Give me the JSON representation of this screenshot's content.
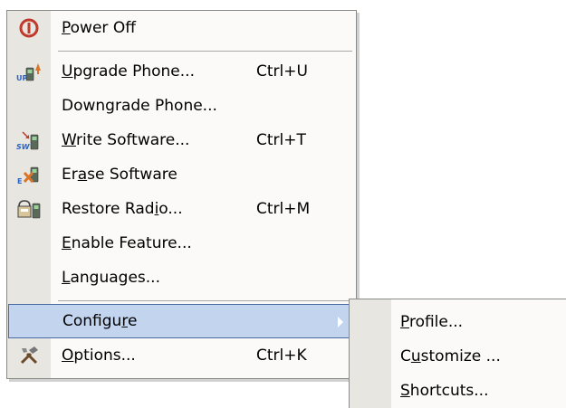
{
  "menu": {
    "items": [
      {
        "id": "power-off",
        "label": "Power Off",
        "mnemonic_index": 0,
        "shortcut": "",
        "icon": "power-icon"
      },
      {
        "id": "upgrade-phone",
        "label": "Upgrade Phone...",
        "mnemonic_index": 0,
        "shortcut": "Ctrl+U",
        "icon": "upgrade-phone-icon"
      },
      {
        "id": "downgrade-phone",
        "label": "Downgrade Phone...",
        "mnemonic_index": -1,
        "shortcut": "",
        "icon": ""
      },
      {
        "id": "write-software",
        "label": "Write Software...",
        "mnemonic_index": 0,
        "shortcut": "Ctrl+T",
        "icon": "write-software-icon"
      },
      {
        "id": "erase-software",
        "label": "Erase Software",
        "mnemonic_index": 2,
        "shortcut": "",
        "icon": "erase-software-icon"
      },
      {
        "id": "restore-radio",
        "label": "Restore Radio...",
        "mnemonic_index": 11,
        "shortcut": "Ctrl+M",
        "icon": "restore-radio-icon"
      },
      {
        "id": "enable-feature",
        "label": "Enable Feature...",
        "mnemonic_index": 0,
        "shortcut": "",
        "icon": ""
      },
      {
        "id": "languages",
        "label": "Languages...",
        "mnemonic_index": 0,
        "shortcut": "",
        "icon": ""
      },
      {
        "id": "configure",
        "label": "Configure",
        "mnemonic_index": 7,
        "shortcut": "",
        "icon": "",
        "highlighted": true,
        "has_submenu": true
      },
      {
        "id": "options",
        "label": "Options...",
        "mnemonic_index": 0,
        "shortcut": "Ctrl+K",
        "icon": "tools-icon"
      }
    ],
    "highlight_color": "#c2d4ee"
  },
  "submenu": {
    "items": [
      {
        "id": "profile",
        "label": "Profile...",
        "mnemonic_index": 0
      },
      {
        "id": "customize",
        "label": "Customize ...",
        "mnemonic_index": 1
      },
      {
        "id": "shortcuts",
        "label": "Shortcuts...",
        "mnemonic_index": 0
      }
    ]
  }
}
